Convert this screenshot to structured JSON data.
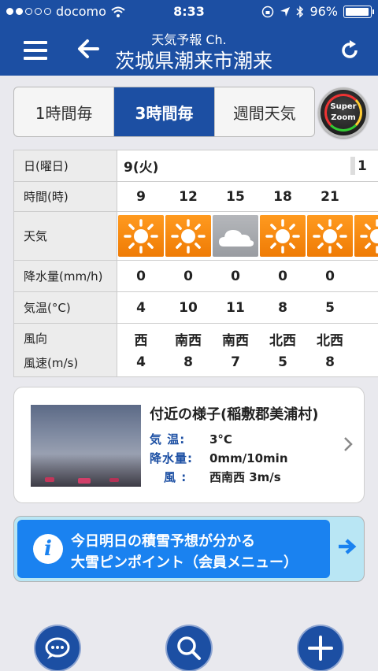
{
  "status": {
    "carrier": "docomo",
    "time": "8:33",
    "battery": "96%"
  },
  "header": {
    "subtitle": "天気予報 Ch.",
    "title": "茨城県潮来市潮来"
  },
  "tabs": [
    {
      "label": "1時間毎",
      "active": false
    },
    {
      "label": "3時間毎",
      "active": true
    },
    {
      "label": "週間天気",
      "active": false
    }
  ],
  "zoom": {
    "line1": "Super",
    "line2": "Zoom"
  },
  "forecast": {
    "labels": {
      "date": "日(曜日)",
      "time": "時間(時)",
      "weather": "天気",
      "precip": "降水量(mm/h)",
      "temp": "気温(°C)",
      "wind_dir": "風向",
      "wind_speed": "風速(m/s)"
    },
    "date": "9(火)",
    "next_date_partial": "1",
    "hours": [
      "9",
      "12",
      "15",
      "18",
      "21"
    ],
    "weather": [
      "sunny",
      "sunny",
      "cloudy",
      "sunny",
      "sunny",
      "sunny"
    ],
    "precip": [
      "0",
      "0",
      "0",
      "0",
      "0"
    ],
    "temp": [
      "4",
      "10",
      "11",
      "8",
      "5"
    ],
    "wind_dir": [
      "西",
      "南西",
      "南西",
      "北西",
      "北西"
    ],
    "wind_speed": [
      "4",
      "8",
      "7",
      "5",
      "8"
    ]
  },
  "nearby": {
    "title": "付近の様子(稲敷郡美浦村)",
    "temp_label": "気 温:",
    "temp_value": "3°C",
    "precip_label": "降水量:",
    "precip_value": "0mm/10min",
    "wind_label": "風 :",
    "wind_value": "西南西 3m/s"
  },
  "banner": {
    "line1": "今日明日の積雪予想が分かる",
    "line2": "大雪ピンポイント（会員メニュー）"
  },
  "colors": {
    "header": "#1c4fa3",
    "sunny": "#f68a12",
    "banner": "#1a82f0"
  }
}
